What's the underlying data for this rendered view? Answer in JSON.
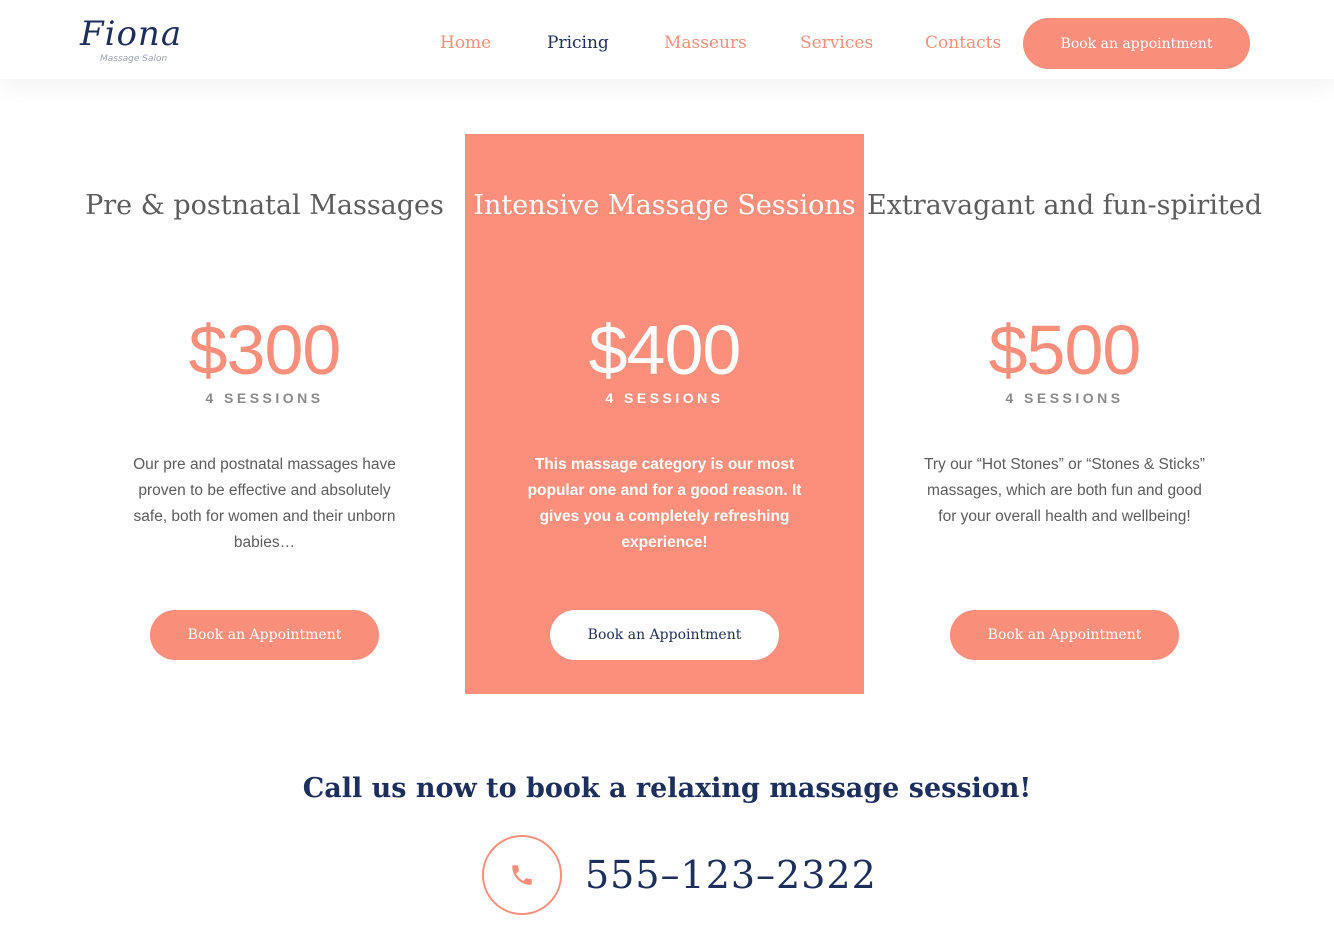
{
  "brand": {
    "logo_text": "Fiona",
    "logo_subtitle": "Massage Salon",
    "accent_color": "#f98e7a",
    "navy_color": "#1d2f5c"
  },
  "nav": {
    "items": [
      {
        "label": "Home",
        "active": false
      },
      {
        "label": "Pricing",
        "active": true
      },
      {
        "label": "Masseurs",
        "active": false
      },
      {
        "label": "Services",
        "active": false
      },
      {
        "label": "Contacts",
        "active": false
      }
    ],
    "cta_label": "Book an appointment"
  },
  "pricing": {
    "cards": [
      {
        "title": "Pre & postnatal Massages",
        "price": "$300",
        "sessions": "4 SESSIONS",
        "description": "Our pre and postnatal massages have proven to be effective and absolutely safe, both for women and their unborn babies…",
        "button_label": "Book an Appointment",
        "featured": false
      },
      {
        "title": "Intensive Massage Sessions",
        "price": "$400",
        "sessions": "4 SESSIONS",
        "description": "This massage category is our most popular one and for a good reason. It gives you a completely refreshing experience!",
        "button_label": "Book an Appointment",
        "featured": true
      },
      {
        "title": "Extravagant and fun-spirited",
        "price": "$500",
        "sessions": "4 SESSIONS",
        "description": "Try our “Hot Stones” or “Stones & Sticks” massages, which are both fun and good for your overall health and wellbeing!",
        "button_label": "Book an Appointment",
        "featured": false
      }
    ]
  },
  "contact": {
    "heading": "Call us now to book a relaxing massage session!",
    "phone_icon": "phone-icon",
    "phone_number": "555–123–2322"
  }
}
